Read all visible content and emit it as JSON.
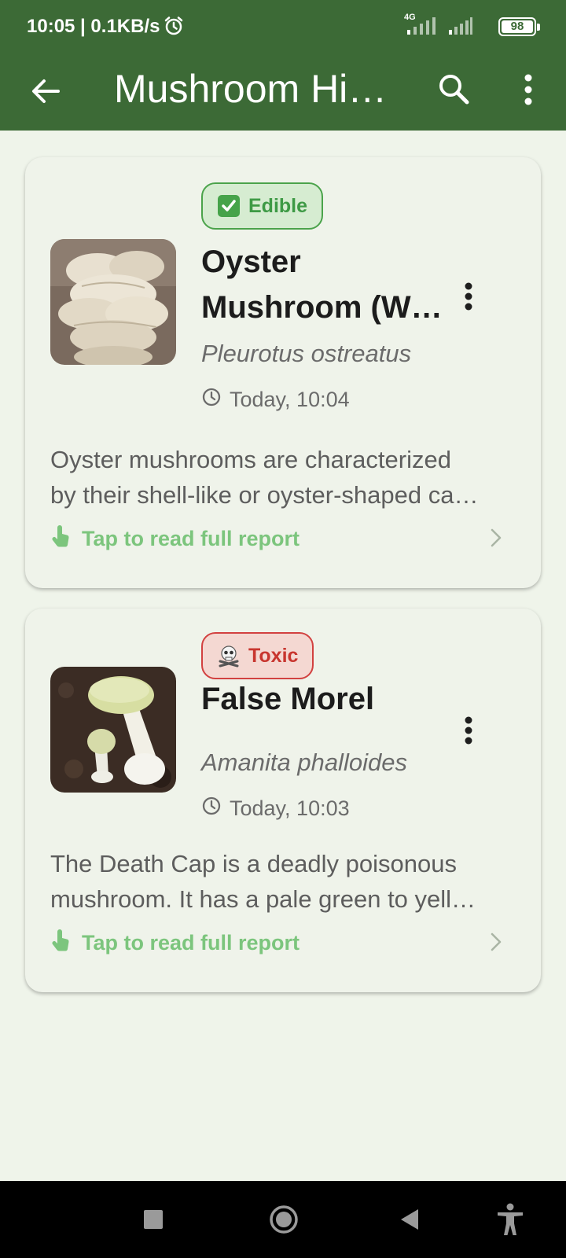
{
  "status_bar": {
    "time_speed": "10:05 | 0.1KB/s",
    "network": "4G",
    "battery": "98"
  },
  "app_bar": {
    "title": "Mushroom Hi…"
  },
  "history": [
    {
      "badge": "Edible",
      "badge_icon": "check-box-icon",
      "name_line1": "Oyster",
      "name_line2": "Mushroom (W…",
      "scientific_name": "Pleurotus ostreatus",
      "timestamp": "Today, 10:04",
      "desc_line1": "Oyster mushrooms are characterized",
      "desc_line2": "by their shell-like or oyster-shaped ca…",
      "cta": "Tap to read full report"
    },
    {
      "badge": "Toxic",
      "badge_icon": "skull-crossbones-icon",
      "name_line1": "False Morel",
      "scientific_name": "Amanita phalloides",
      "timestamp": "Today, 10:03",
      "desc_line1": "The Death Cap is a deadly poisonous",
      "desc_line2": "mushroom.  It has a pale green to yell…",
      "cta": "Tap to read full report"
    }
  ],
  "colors": {
    "app_bar": "#3c6a36",
    "background": "#eff4ea",
    "edible": "#3e9a45",
    "toxic": "#c8362f",
    "link": "#7cc57d"
  }
}
